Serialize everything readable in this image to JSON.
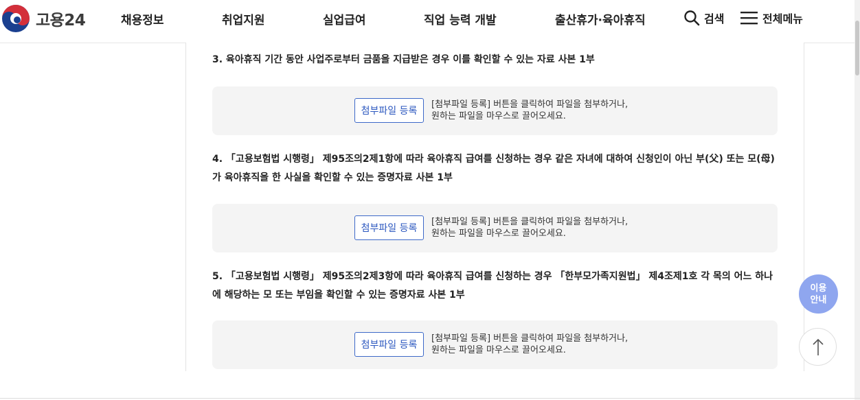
{
  "header": {
    "logo_text": "고용24",
    "nav": [
      "채용정보",
      "취업지원",
      "실업급여",
      "직업 능력 개발",
      "출산휴가·육아휴직"
    ],
    "search_label": "검색",
    "menu_label": "전체메뉴"
  },
  "items": [
    {
      "text": "3. 육아휴직 기간 동안 사업주로부터 금품을 지급받은 경우 이를 확인할 수 있는 자료 사본 1부"
    },
    {
      "text": "4. 「고용보험법 시행령」 제95조의2제1항에 따라 육아휴직 급여를 신청하는 경우 같은 자녀에 대하여 신청인이 아닌 부(父) 또는 모(母)가 육아휴직을 한 사실을 확인할 수 있는 증명자료 사본 1부"
    },
    {
      "text": "5. 「고용보험법 시행령」 제95조의2제3항에 따라 육아휴직 급여를 신청하는 경우 「한부모가족지원법」 제4조제1호 각 목의 어느 하나에 해당하는 모 또는 부임을 확인할 수 있는 증명자료 사본 1부"
    }
  ],
  "upload": {
    "button_label": "첨부파일 등록",
    "guide_line1": "[첨부파일 등록] 버튼을 클릭하여 파일을 첨부하거나,",
    "guide_line2": "원하는 파일을 마우스로 끌어오세요."
  },
  "side": {
    "guide_line1": "이용",
    "guide_line2": "안내"
  },
  "colors": {
    "accent": "#2b57bf",
    "side_badge": "#8fa6ef",
    "upload_bg": "#f4f4f4"
  }
}
